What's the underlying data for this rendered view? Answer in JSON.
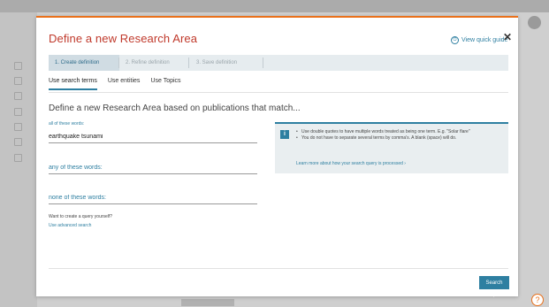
{
  "modal": {
    "title": "Define a new Research Area",
    "quick_guide_label": "View quick guide",
    "close_glyph": "✕"
  },
  "stepper": {
    "steps": [
      {
        "label": "1. Create definition",
        "active": true
      },
      {
        "label": "2. Refine definition",
        "active": false
      },
      {
        "label": "3. Save definition",
        "active": false
      }
    ]
  },
  "tabs": [
    {
      "label": "Use search terms",
      "active": true
    },
    {
      "label": "Use entities",
      "active": false
    },
    {
      "label": "Use Topics",
      "active": false
    }
  ],
  "heading": "Define a new Research Area based on publications that match...",
  "fields": {
    "all": {
      "label": "all of these words:",
      "value": "earthquake tsunami"
    },
    "any": {
      "placeholder": "any of these words:",
      "value": ""
    },
    "none": {
      "placeholder": "none of these words:",
      "value": ""
    }
  },
  "advanced": {
    "prompt": "Want to create a query yourself?",
    "link": "Use advanced search"
  },
  "info": {
    "icon": "i",
    "bullets": [
      "Use double quotes to have multiple words treated as being one term. E.g. \"Solar flare\"",
      "You do not have to separate several terms by comma's. A blank (space) will do."
    ],
    "link": "Learn more about how your search query is processed ›"
  },
  "footer": {
    "search_label": "Search ›"
  },
  "help_glyph": "?",
  "colors": {
    "accent_orange": "#e9711c",
    "title_red": "#c0392b",
    "link_blue": "#2e7fa1"
  },
  "icons": {
    "quick_guide": "clock-icon",
    "close": "close-icon",
    "info": "info-icon",
    "help": "help-icon"
  }
}
